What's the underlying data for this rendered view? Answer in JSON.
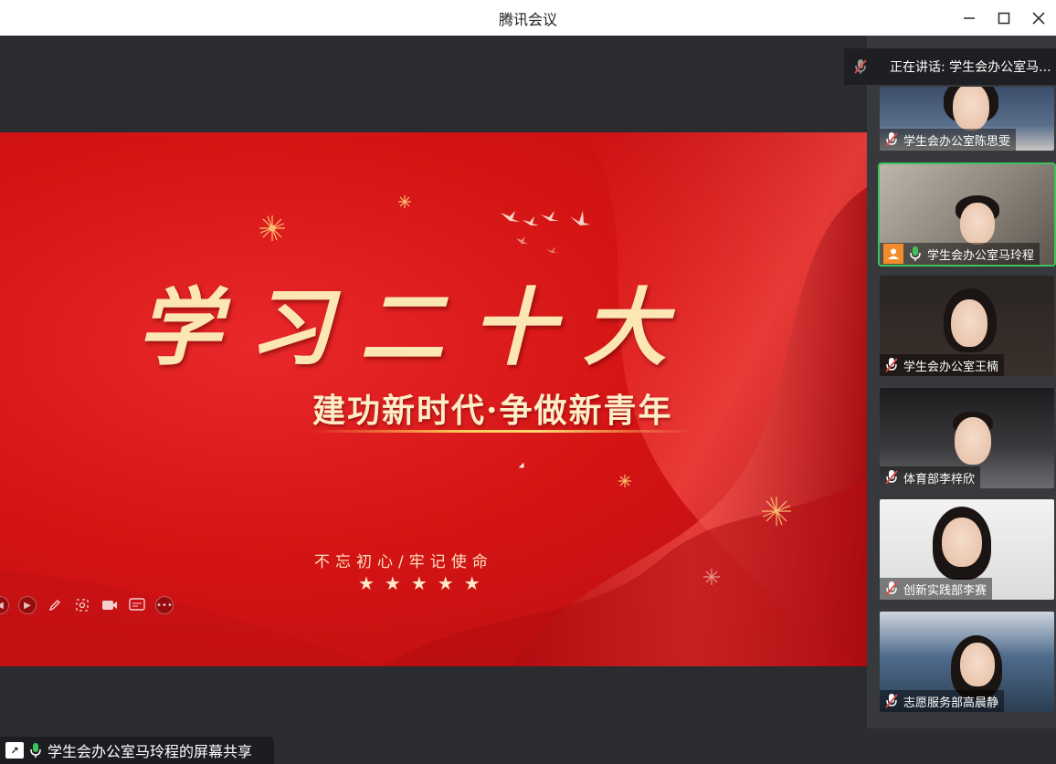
{
  "window": {
    "title": "腾讯会议"
  },
  "slide": {
    "headline": "学习二十大",
    "subline": "建功新时代·争做新青年",
    "motto": "不忘初心/牢记使命",
    "stars": "★★★★★"
  },
  "share_status": {
    "text": "学生会办公室马玲程的屏幕共享"
  },
  "speaking": {
    "text": "正在讲话: 学生会办公室马..."
  },
  "participants": [
    {
      "name": "学生会办公室陈思雯",
      "mic": "muted",
      "active": false
    },
    {
      "name": "学生会办公室马玲程",
      "mic": "on",
      "active": true
    },
    {
      "name": "学生会办公室王楠",
      "mic": "muted",
      "active": false
    },
    {
      "name": "体育部李梓欣",
      "mic": "muted",
      "active": false
    },
    {
      "name": "创新实践部李赛",
      "mic": "muted",
      "active": false
    },
    {
      "name": "志愿服务部高晨静",
      "mic": "muted",
      "active": false
    }
  ],
  "colors": {
    "slide_red": "#d51414",
    "gold": "#fbe6b4",
    "mic_green": "#3fc25c",
    "active_border": "#3fc25c",
    "avatar_orange": "#f28b2c"
  },
  "icons": [
    "minimize-icon",
    "maximize-icon",
    "close-icon",
    "mic-muted-icon",
    "mic-on-icon",
    "screen-share-icon",
    "user-avatar-icon"
  ]
}
